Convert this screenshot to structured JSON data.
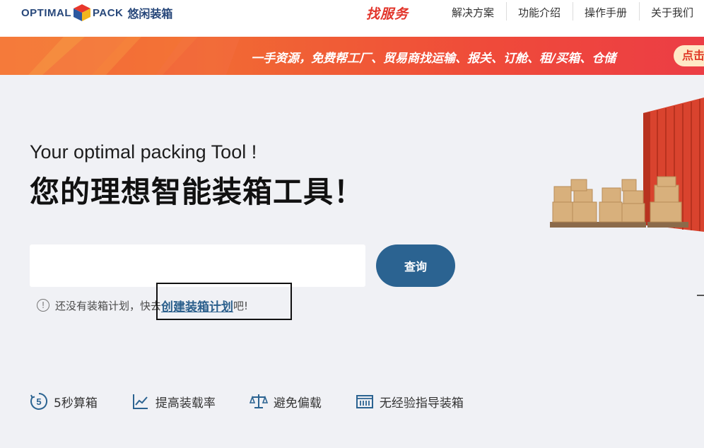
{
  "header": {
    "logo": {
      "left": "OPTIMAL",
      "right": "PACK",
      "cn": "悠闲装箱"
    },
    "service_link": "找服务",
    "nav": [
      "解决方案",
      "功能介绍",
      "操作手册",
      "关于我们"
    ]
  },
  "banner": {
    "text": "一手资源，免费帮工厂、贸易商找运输、报关、订舱、租/买箱、仓储",
    "button": "点击"
  },
  "hero": {
    "en": "Your optimal packing Tool !",
    "cn": "您的理想智能装箱工具！"
  },
  "search": {
    "value": "",
    "button": "查询"
  },
  "hint": {
    "icon": "!",
    "prefix": "还没有装箱计划，快去",
    "link": "创建装箱计划",
    "suffix": "吧!"
  },
  "features": [
    {
      "icon": "five-seconds-icon",
      "label": "5秒算箱"
    },
    {
      "icon": "trend-chart-icon",
      "label": "提高装载率"
    },
    {
      "icon": "balance-scale-icon",
      "label": "避免偏载"
    },
    {
      "icon": "container-icon",
      "label": "无经验指导装箱"
    }
  ],
  "colors": {
    "brand_blue": "#2b6391",
    "banner_orange": "#f16a33",
    "accent_red": "#e2352b"
  }
}
